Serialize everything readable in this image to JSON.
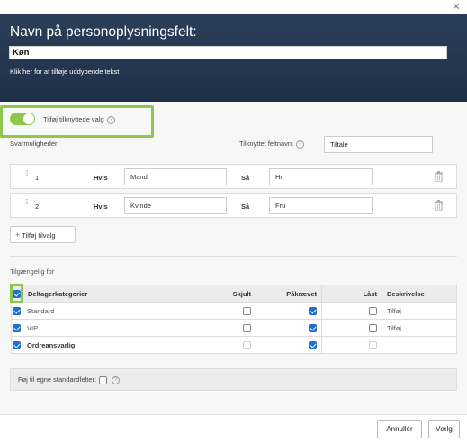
{
  "header": {
    "title": "Navn på personoplysningsfelt:",
    "name_value": "Køn",
    "desc_link": "Klik her for at tilføje uddybende tekst"
  },
  "toggle": {
    "label": "Tilføj tilknyttede valg",
    "on": true
  },
  "options": {
    "label": "Svarmuligheder:",
    "linked_field_label": "Tilknyttet feltnavn:",
    "linked_field_value": "Tiltale",
    "rows": [
      {
        "num": "1",
        "hvis": "Hvis",
        "value": "Mand",
        "saa": "Så",
        "result": "Hr."
      },
      {
        "num": "2",
        "hvis": "Hvis",
        "value": "Kvinde",
        "saa": "Så",
        "result": "Fru"
      }
    ],
    "add_label": "Tilføj tilvalg"
  },
  "available": {
    "label": "Tilgængelig for",
    "headers": [
      "Deltagerkategorier",
      "Skjult",
      "Påkrævet",
      "Låst",
      "Beskrivelse"
    ],
    "rows": [
      {
        "name": "Standard",
        "desc": "Tilføj"
      },
      {
        "name": "VIP",
        "desc": "Tilføj"
      },
      {
        "name": "Ordreansvarlig",
        "desc": ""
      }
    ]
  },
  "own_fields_label": "Føj til egne standardfelter:",
  "footer": {
    "cancel": "Annullér",
    "choose": "Vælg"
  },
  "colors": {
    "header_bg": "#1f3149",
    "accent_green": "#8cc84b",
    "checkbox_blue": "#1e6fd1"
  }
}
